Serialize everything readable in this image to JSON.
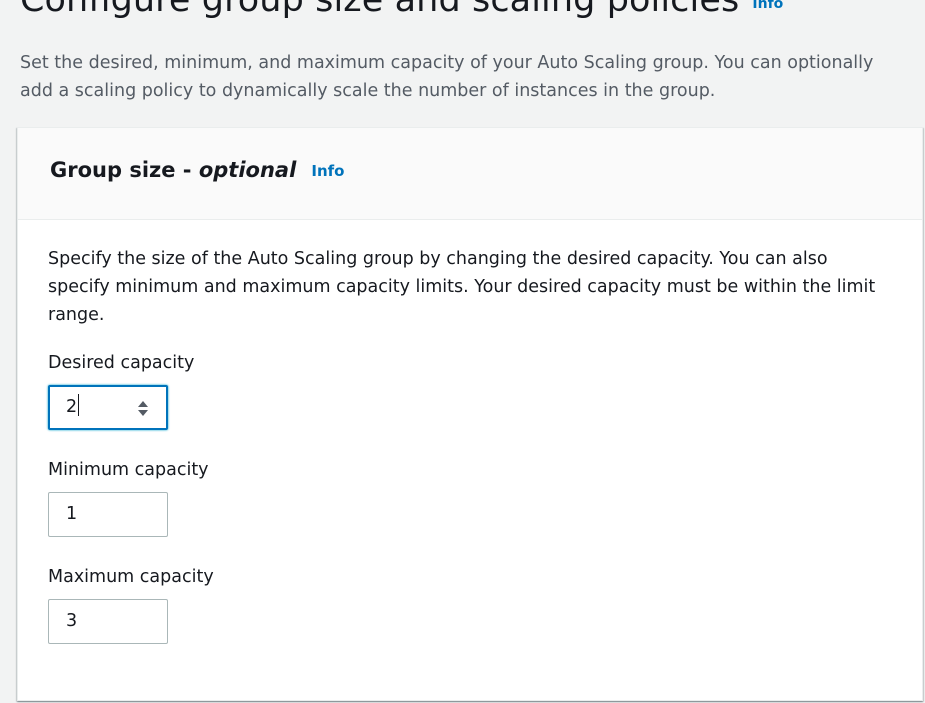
{
  "page": {
    "title": "Configure group size and scaling policies",
    "info_label": "Info",
    "description": "Set the desired, minimum, and maximum capacity of your Auto Scaling group. You can optionally add a scaling policy to dynamically scale the number of instances in the group."
  },
  "group_size": {
    "title": "Group size - ",
    "optional_label": "optional",
    "info_label": "Info",
    "description": "Specify the size of the Auto Scaling group by changing the desired capacity. You can also specify minimum and maximum capacity limits. Your desired capacity must be within the limit range.",
    "desired": {
      "label": "Desired capacity",
      "value": "2"
    },
    "minimum": {
      "label": "Minimum capacity",
      "value": "1"
    },
    "maximum": {
      "label": "Maximum capacity",
      "value": "3"
    }
  },
  "colors": {
    "link": "#0073bb",
    "focus": "#0073bb",
    "background": "#f2f3f3"
  },
  "icons": {
    "stepper": "up-down-arrows-icon"
  }
}
